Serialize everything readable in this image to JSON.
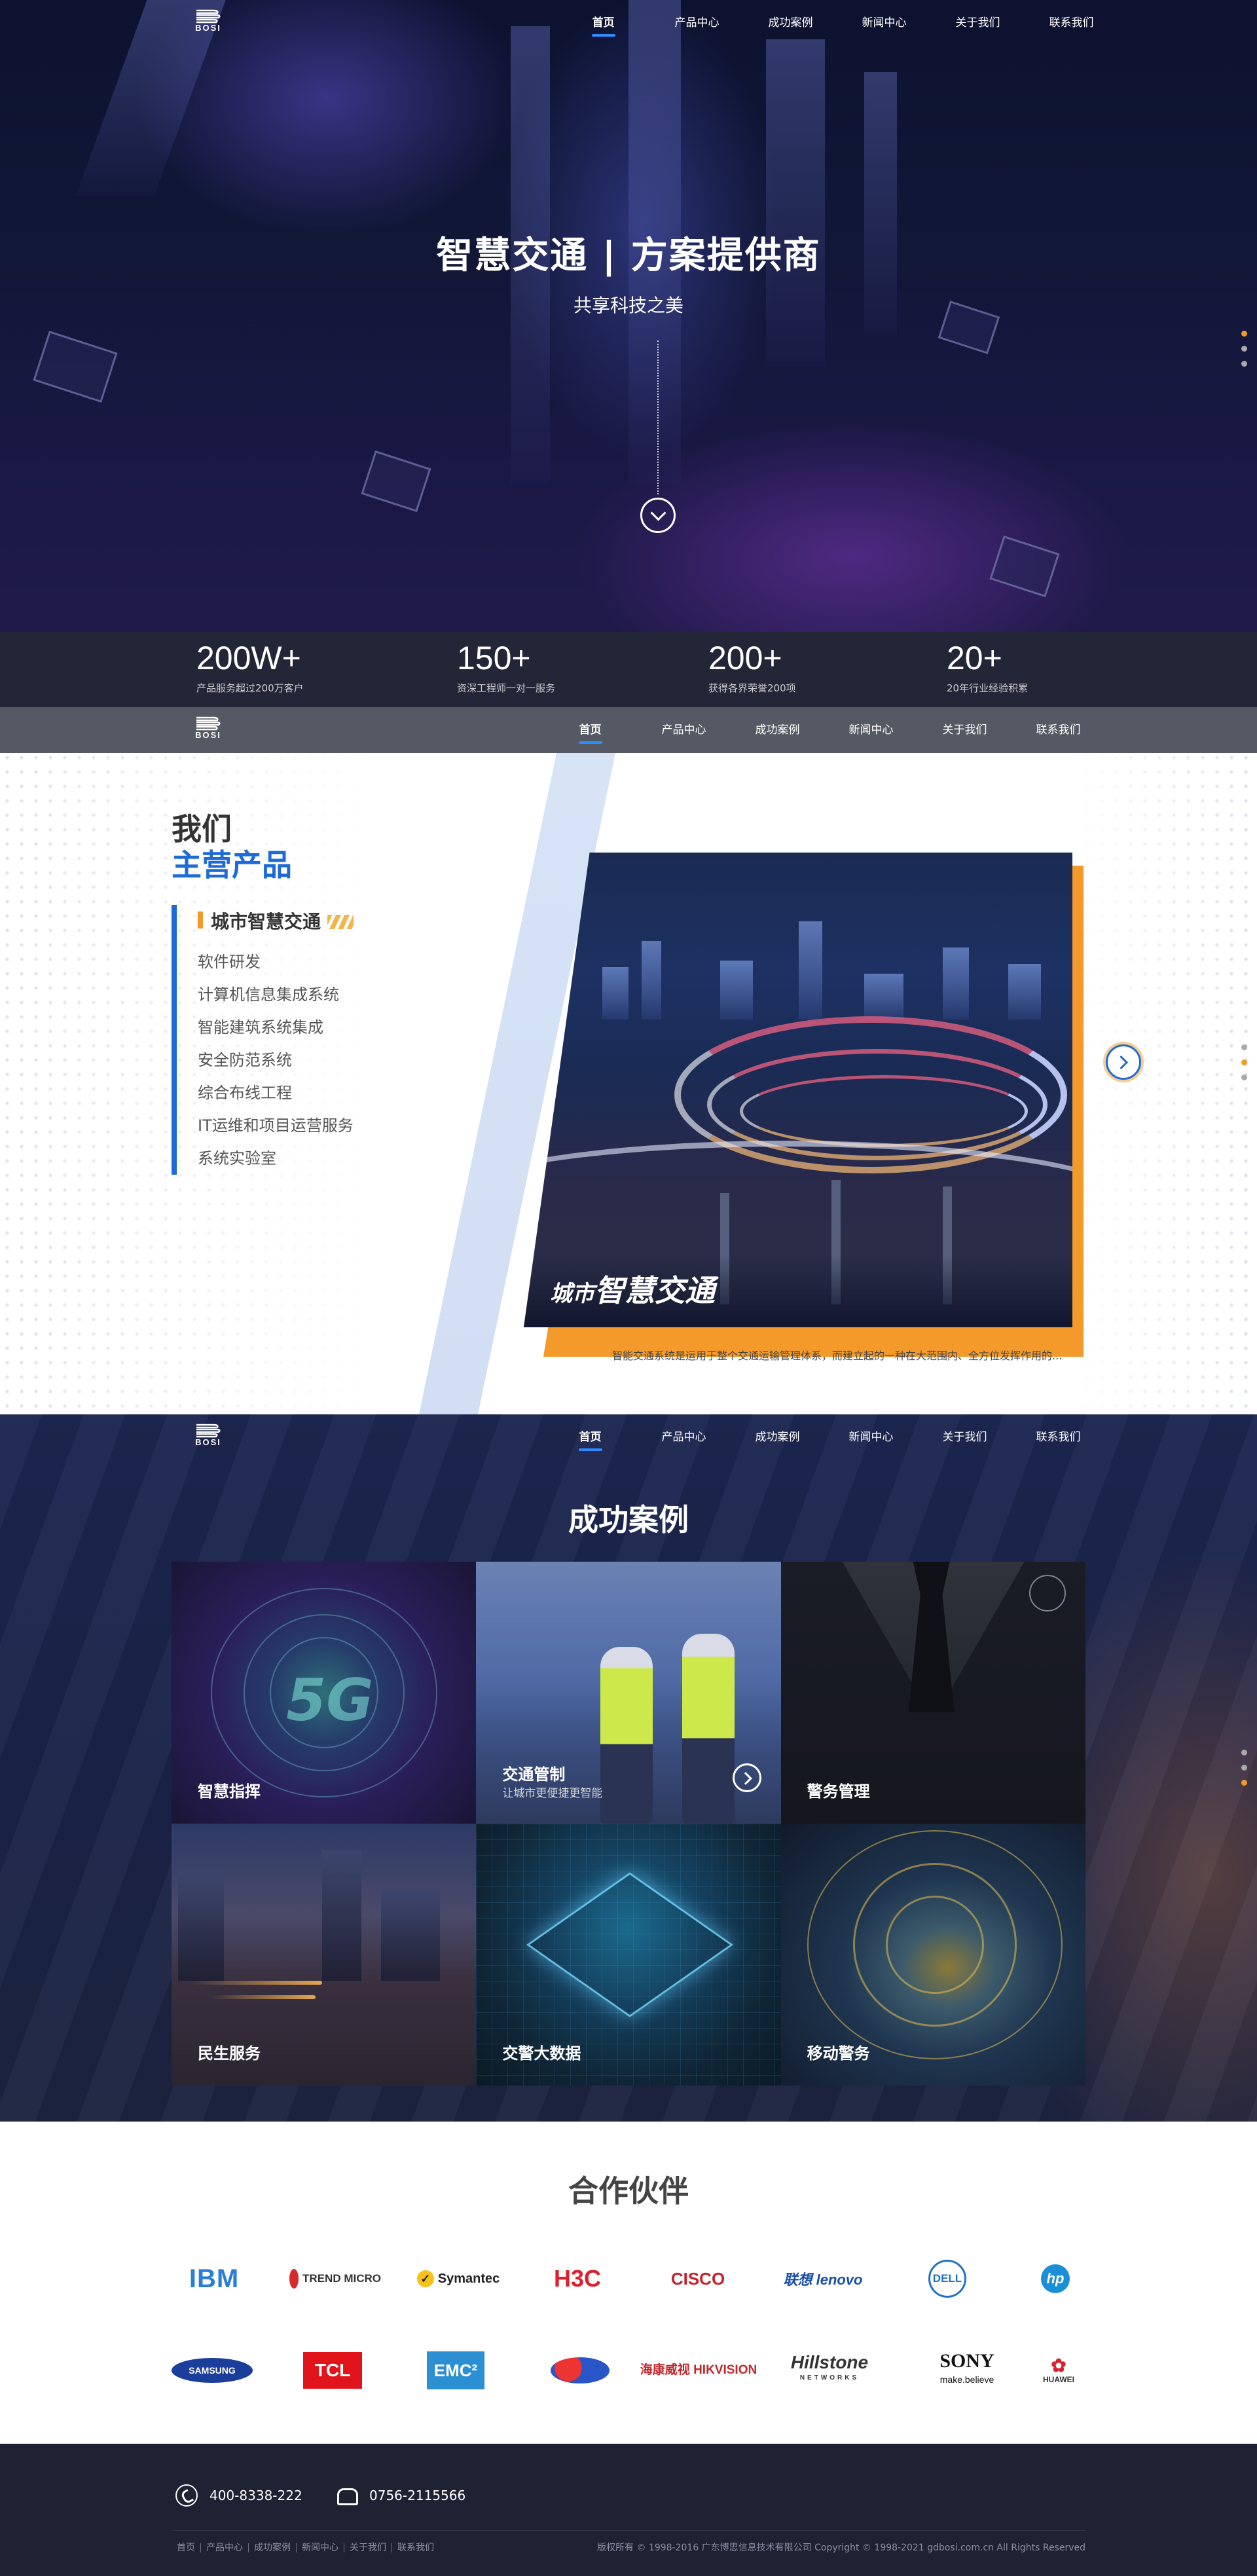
{
  "nav": {
    "logo_text": "BOSI",
    "items": [
      "首页",
      "产品中心",
      "成功案例",
      "新闻中心",
      "关于我们",
      "联系我们"
    ]
  },
  "hero": {
    "title": "智慧交通 | 方案提供商",
    "subtitle": "共享科技之美"
  },
  "stats": [
    {
      "value": "200W+",
      "desc": "产品服务超过200万客户"
    },
    {
      "value": "150+",
      "desc": "资深工程师一对一服务"
    },
    {
      "value": "200+",
      "desc": "获得各界荣誉200项"
    },
    {
      "value": "20+",
      "desc": "20年行业经验积累"
    }
  ],
  "products": {
    "heading_line1": "我们",
    "heading_line2": "主营产品",
    "current": "城市智慧交通",
    "items": [
      "软件研发",
      "计算机信息集成系统",
      "智能建筑系统集成",
      "安全防范系统",
      "综合布线工程",
      "IT运维和项目运营服务",
      "系统实验室"
    ],
    "caption_small": "城市",
    "caption_big": "智慧交通",
    "description": "智能交通系统是运用于整个交通运输管理体系，而建立起的一种在大范围内、全方位发挥作用的..."
  },
  "cases": {
    "title": "成功案例",
    "items": [
      {
        "label": "智慧指挥",
        "tag": ""
      },
      {
        "label": "交通管制",
        "tag": "让城市更便捷更智能"
      },
      {
        "label": "警务管理",
        "tag": ""
      },
      {
        "label": "民生服务",
        "tag": ""
      },
      {
        "label": "交警大数据",
        "tag": ""
      },
      {
        "label": "移动警务",
        "tag": ""
      }
    ],
    "tile1_mark": "5G"
  },
  "partners": {
    "title": "合作伙伴",
    "row1": [
      "IBM",
      "TREND MICRO",
      "Symantec",
      "H3C",
      "CISCO",
      "联想 lenovo",
      "DELL",
      "hp"
    ],
    "row2": [
      "SAMSUNG",
      "TCL",
      "EMC²",
      "",
      "海康威视 HIKVISION",
      "Hillstone",
      "SONY",
      "HUAWEI"
    ],
    "sony_sub": "make.believe",
    "hillstone_sub": "NETWORKS"
  },
  "footer": {
    "phone": "400-8338-222",
    "fax": "0756-2115566",
    "links": [
      "首页",
      "产品中心",
      "成功案例",
      "新闻中心",
      "关于我们",
      "联系我们"
    ],
    "copyright": "版权所有 © 1998-2016 广东博思信息技术有限公司 Copyright © 1998-2021 gdbosi.com.cn All Rights Reserved"
  },
  "colors": {
    "accent_blue": "#1f6bd6",
    "accent_orange": "#f39a2a",
    "footer_bg": "#1e2233"
  },
  "icons": {
    "scroll_down": "chevron-down-icon",
    "next": "chevron-right-icon",
    "phone": "phone-icon",
    "fax": "fax-icon"
  }
}
